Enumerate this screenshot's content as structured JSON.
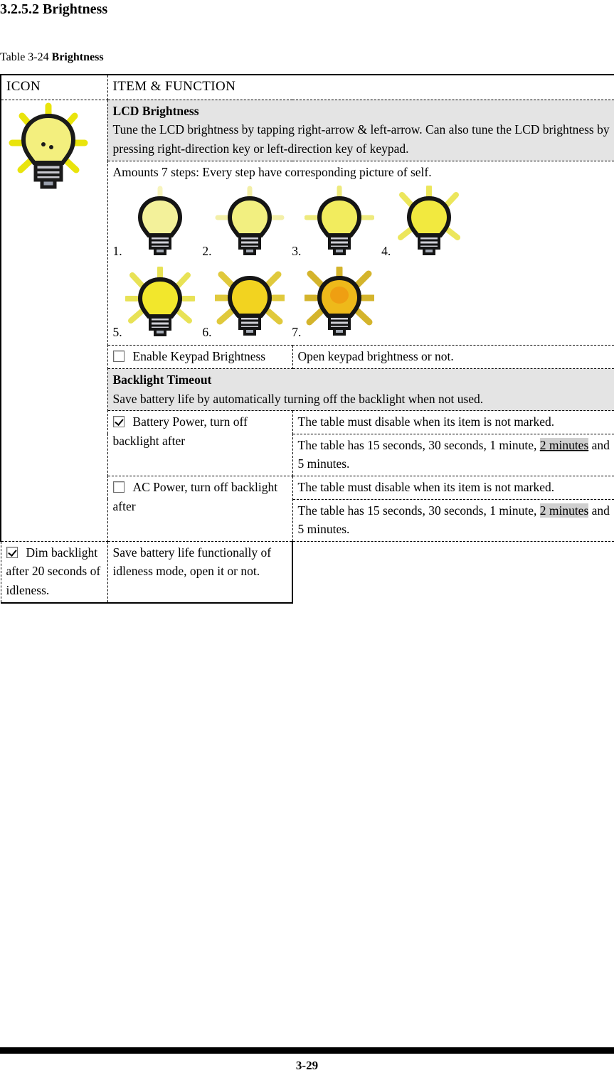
{
  "heading": "3.2.5.2 Brightness",
  "caption": {
    "prefix": "Table 3-24 ",
    "bold": "Brightness"
  },
  "table": {
    "headers": {
      "icon": "ICON",
      "item": "ITEM & FUNCTION"
    },
    "lcd_brightness": {
      "title": "LCD Brightness",
      "body": "Tune the LCD brightness by tapping right-arrow & left-arrow. Can also tune the LCD brightness by pressing right-direction key or left-direction key of keypad."
    },
    "steps": {
      "intro": "Amounts 7 steps: Every step have corresponding picture of self.",
      "labels": [
        "1.",
        "2.",
        "3.",
        "4.",
        "5.",
        "6.",
        "7."
      ]
    },
    "keypad": {
      "checkbox_checked": false,
      "label": "Enable Keypad Brightness",
      "description": "Open keypad brightness or not."
    },
    "backlight_timeout": {
      "title": "Backlight Timeout",
      "body": "Save battery life by automatically turning off the backlight when not used."
    },
    "battery_power": {
      "checkbox_checked": true,
      "label": "Battery Power, turn off backlight after",
      "desc1": "The table must disable when its item is not marked.",
      "desc2_pre": "The table has 15 seconds, 30 seconds, 1 minute, ",
      "desc2_hl": "2 minutes",
      "desc2_post": " and 5 minutes."
    },
    "ac_power": {
      "checkbox_checked": false,
      "label": "AC Power, turn off backlight after",
      "desc1": "The table must disable when its item is not marked.",
      "desc2_pre": "The table has 15 seconds, 30 seconds, 1 minute, ",
      "desc2_hl": "2 minutes",
      "desc2_post": " and 5 minutes."
    },
    "dim_backlight": {
      "checkbox_checked": true,
      "label": "Dim backlight after 20 seconds of idleness.",
      "description": "Save battery life functionally of idleness mode, open it or not."
    }
  },
  "footer": {
    "page_number": "3-29"
  },
  "colors": {
    "shaded_row": "#e4e4e4",
    "highlight": "#cfcfcf",
    "bulb_pale": "#f2f08a",
    "bulb_yellow": "#f5e93a",
    "bulb_gold": "#f0c419",
    "bulb_orange": "#eda312",
    "ray_pale": "#f6f3b0",
    "ray_yellow": "#ece85a",
    "ray_gold": "#d6b82e"
  }
}
